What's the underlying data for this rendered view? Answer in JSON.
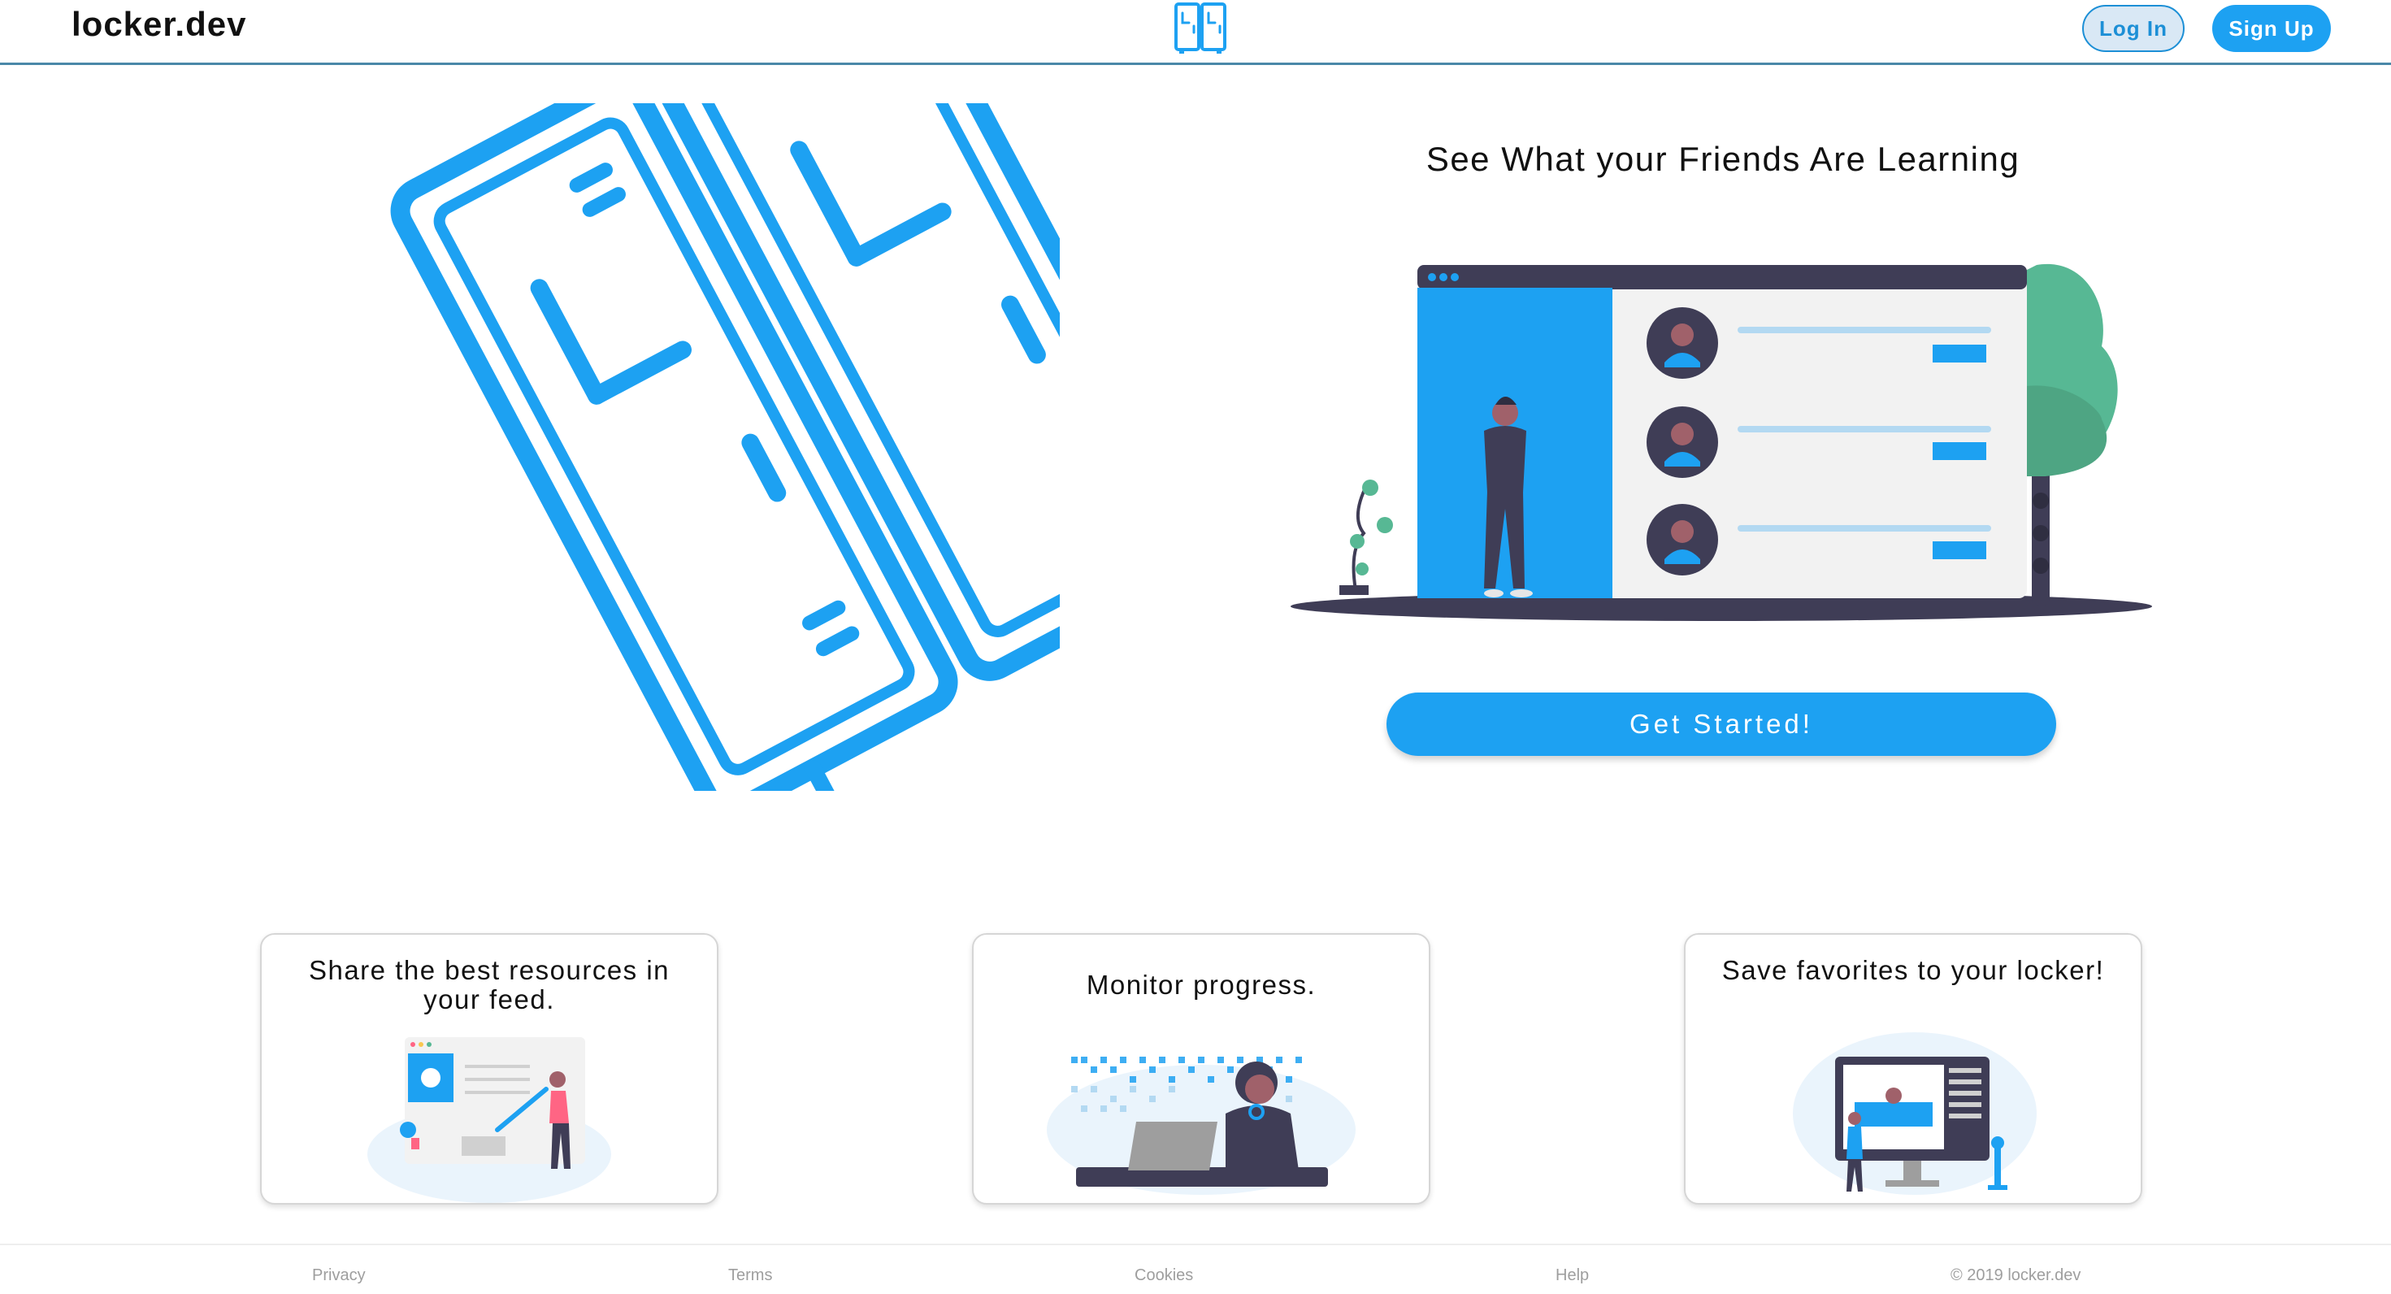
{
  "header": {
    "brand": "locker.dev",
    "login_label": "Log In",
    "signup_label": "Sign Up"
  },
  "hero": {
    "title": "See What your Friends Are Learning",
    "cta_label": "Get Started!"
  },
  "features": [
    {
      "title": "Share the best resources in your feed."
    },
    {
      "title": "Monitor progress."
    },
    {
      "title": "Save favorites to your locker!"
    }
  ],
  "footer": {
    "links": [
      "Privacy",
      "Terms",
      "Cookies",
      "Help"
    ],
    "copyright": "© 2019 locker.dev"
  },
  "colors": {
    "accent": "#1da1f2",
    "header_border": "#4a88a8",
    "dark_navy": "#3f3d56",
    "tree_green": "#57b894"
  },
  "icons": {
    "logo": "locker-icon",
    "hero_art": "lockers-illustration",
    "people_illustration": "friends-feed-illustration"
  }
}
